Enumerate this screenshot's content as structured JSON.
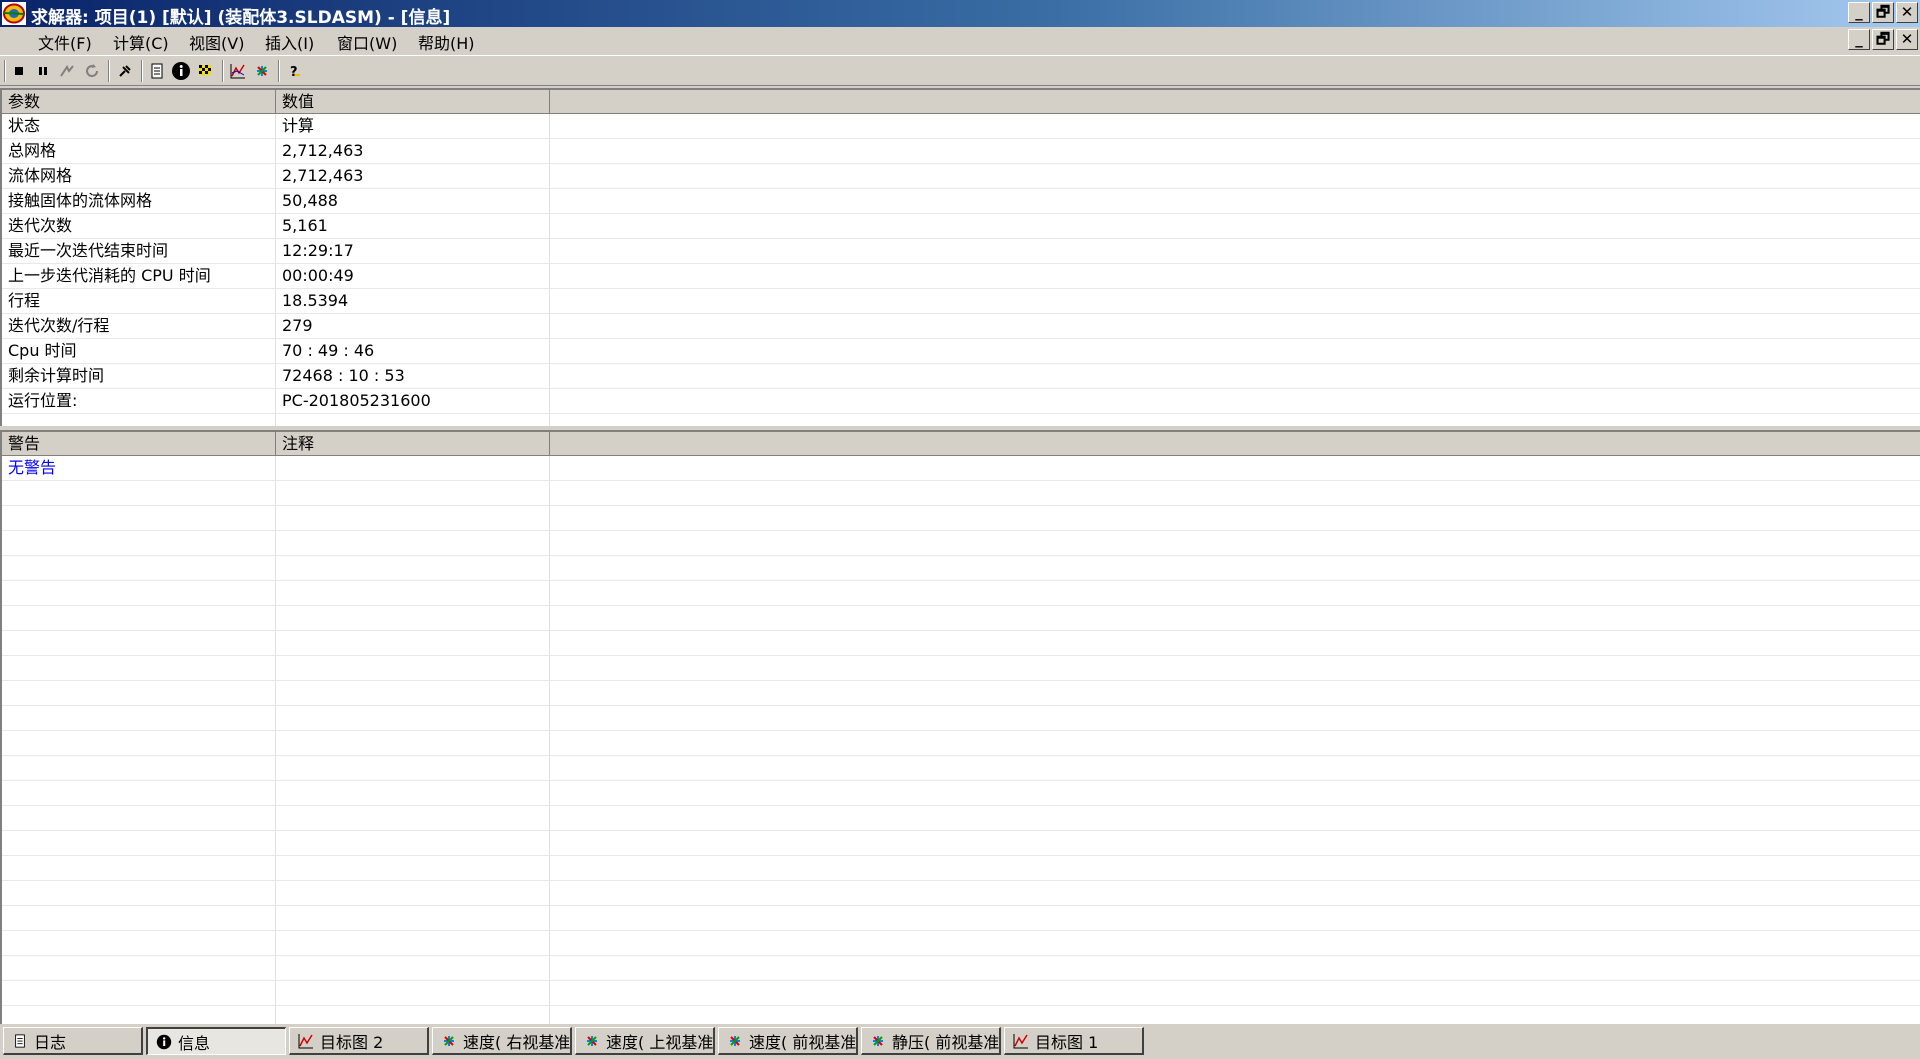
{
  "window": {
    "title": "求解器: 项目(1) [默认] (装配体3.SLDASM) - [信息]",
    "controls": {
      "minimize": "_",
      "restore": "🗗",
      "close": "✕"
    }
  },
  "menu": [
    {
      "label": "文件(F)"
    },
    {
      "label": "计算(C)"
    },
    {
      "label": "视图(V)"
    },
    {
      "label": "插入(I)"
    },
    {
      "label": "窗口(W)"
    },
    {
      "label": "帮助(H)"
    }
  ],
  "toolbar": {
    "buttons": [
      "stop-icon",
      "pause-icon",
      "step-icon",
      "refresh-icon",
      "pin-icon",
      "log-icon",
      "info-icon",
      "flag-icon",
      "goal-plot-icon",
      "cut-plot-icon",
      "help-icon"
    ]
  },
  "params_table": {
    "headers": [
      "参数",
      "数值"
    ],
    "rows": [
      {
        "param": "状态",
        "value": "计算"
      },
      {
        "param": "总网格",
        "value": "2,712,463"
      },
      {
        "param": "流体网格",
        "value": "2,712,463"
      },
      {
        "param": "接触固体的流体网格",
        "value": "50,488"
      },
      {
        "param": "迭代次数",
        "value": "5,161"
      },
      {
        "param": "最近一次迭代结束时间",
        "value": "12:29:17"
      },
      {
        "param": "上一步迭代消耗的 CPU 时间",
        "value": "00:00:49"
      },
      {
        "param": "行程",
        "value": "18.5394"
      },
      {
        "param": "迭代次数/行程",
        "value": "279"
      },
      {
        "param": "Cpu 时间",
        "value": "70 : 49 : 46"
      },
      {
        "param": "剩余计算时间",
        "value": "72468 : 10 : 53"
      },
      {
        "param": "运行位置:",
        "value": "PC-201805231600"
      }
    ]
  },
  "warnings_table": {
    "headers": [
      "警告",
      "注释"
    ],
    "rows": [
      {
        "warning": "无警告",
        "comment": ""
      }
    ]
  },
  "tabs": [
    {
      "label": "日志",
      "icon": "log-icon"
    },
    {
      "label": "信息",
      "icon": "info-icon",
      "active": true
    },
    {
      "label": "目标图 2",
      "icon": "goal-plot-icon"
    },
    {
      "label": "速度( 右视基准面",
      "icon": "cut-plot-icon"
    },
    {
      "label": "速度( 上视基准面",
      "icon": "cut-plot-icon"
    },
    {
      "label": "速度( 前视基准面",
      "icon": "cut-plot-icon"
    },
    {
      "label": "静压( 前视基准面",
      "icon": "cut-plot-icon"
    },
    {
      "label": "目标图 1",
      "icon": "goal-plot-icon"
    }
  ],
  "colors": {
    "title_start": "#0a246a",
    "title_end": "#a6caf0",
    "face": "#d4d0c8",
    "warning_text": "#0000ff"
  }
}
